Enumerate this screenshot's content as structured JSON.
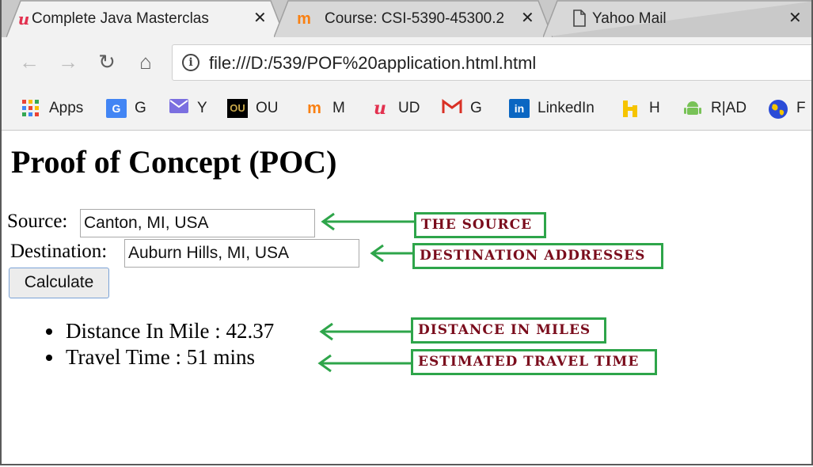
{
  "tabs": [
    {
      "title": "Complete Java Masterclas",
      "favicon": "udemy-icon"
    },
    {
      "title": "Course: CSI-5390-45300.2",
      "favicon": "moodle-icon"
    },
    {
      "title": "Yahoo Mail",
      "favicon": "document-icon"
    }
  ],
  "toolbar": {
    "url": "file:///D:/539/POF%20application.html.html"
  },
  "bookmarks": [
    {
      "label": "Apps",
      "icon": "apps-grid-icon"
    },
    {
      "label": "G",
      "icon": "google-translate-icon"
    },
    {
      "label": "Y",
      "icon": "mail-icon"
    },
    {
      "label": "OU",
      "icon": "ou-logo-icon"
    },
    {
      "label": "M",
      "icon": "moodle-icon"
    },
    {
      "label": "UD",
      "icon": "udemy-icon"
    },
    {
      "label": "G",
      "icon": "gmail-icon"
    },
    {
      "label": "LinkedIn",
      "icon": "linkedin-icon"
    },
    {
      "label": "H",
      "icon": "h-icon"
    },
    {
      "label": "R|AD",
      "icon": "android-icon"
    },
    {
      "label": "F",
      "icon": "globe-icon"
    }
  ],
  "page": {
    "title": "Proof of Concept (POC)",
    "source_label": "Source:",
    "source_value": "Canton, MI, USA",
    "destination_label": "Destination:",
    "destination_value": "Auburn Hills, MI, USA",
    "calculate_label": "Calculate",
    "results": [
      "Distance In Mile : 42.37",
      "Travel Time : 51 mins"
    ]
  },
  "annotations": [
    "The source",
    "Destination addresses",
    "Distance in miles",
    "Estimated travel time"
  ],
  "colors": {
    "annotation_border": "#2ea54a",
    "annotation_text": "#7a0c1c",
    "arrow": "#2ea54a"
  }
}
